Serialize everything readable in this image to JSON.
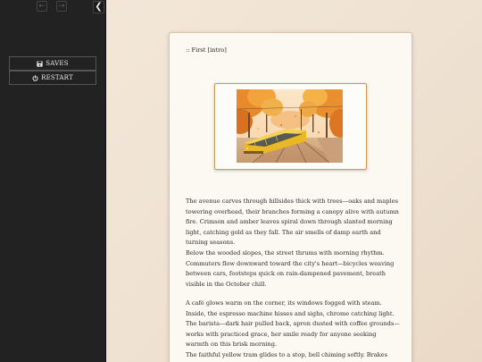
{
  "sidebar": {
    "history_back_icon": "arrow-left-icon",
    "history_forward_icon": "arrow-right-icon",
    "stow_icon": "chevron-left-icon",
    "menu": [
      {
        "label": "SAVES",
        "icon": "save-icon"
      },
      {
        "label": "RESTART",
        "icon": "power-icon"
      }
    ]
  },
  "passage": {
    "title": ":: First [intro]",
    "paragraphs": [
      "The avenue carves through hillsides thick with trees—oaks and maples towering overhead, their branches forming a canopy alive with autumn fire. Crimson and amber leaves spiral down through slanted morning light, catching gold as they fall. The air smells of damp earth and turning seasons.",
      "Below the wooded slopes, the street thrums with morning rhythm. Commuters flow downward toward the city's heart—bicycles weaving between cars, footsteps quick on rain-dampened pavement, breath visible in the October chill.",
      "A café glows warm on the corner, its windows fogged with steam. Inside, the espresso machine hisses and sighs, chrome catching light. The barista—dark hair pulled back, apron dusted with coffee grounds—works with practiced grace, her smile ready for anyone seeking warmth on this brisk morning.",
      "The faithful yellow tram glides to a stop, bell chiming softly. Brakes exhale."
    ]
  },
  "colors": {
    "sidebar_bg": "#222222",
    "page_bg": "#f0e4d6",
    "card_bg": "#fcf8f2",
    "image_border": "#c99a52"
  }
}
